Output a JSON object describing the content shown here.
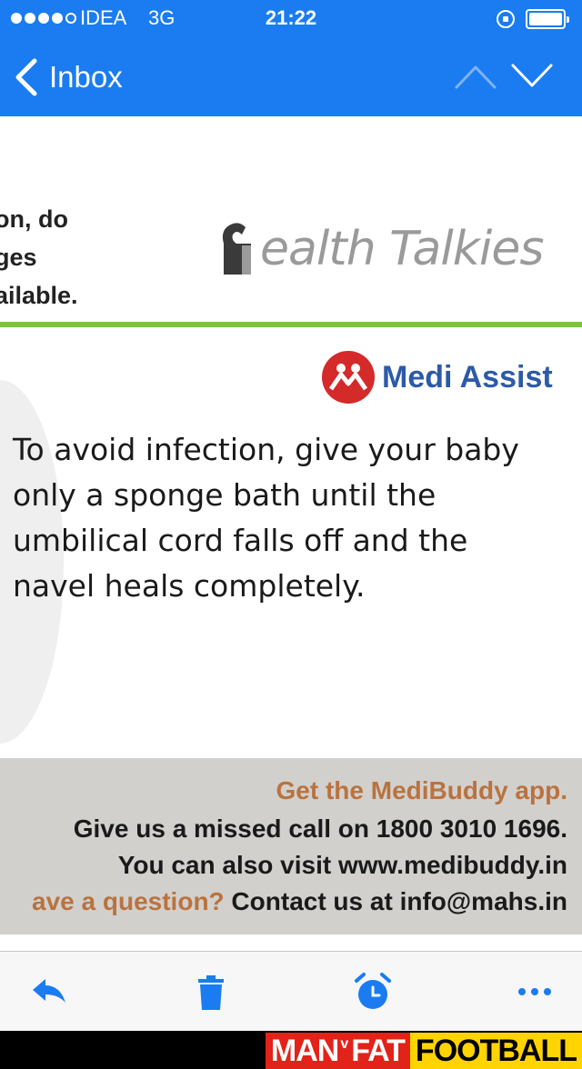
{
  "status_bar": {
    "carrier": "IDEA",
    "network": "3G",
    "time": "21:22"
  },
  "nav": {
    "back_label": "Inbox"
  },
  "email": {
    "left_cut_lines": [
      "on, do",
      "ges",
      "ailable."
    ],
    "brand_logo_text": "ealth Talkies",
    "partner_logo_text": "Medi Assist",
    "message": "To avoid infection, give your baby only a sponge bath until the umbilical cord falls off and the navel heals completely.",
    "footer": {
      "line1": "Get the MediBuddy app.",
      "line2": "Give us a missed call on 1800 3010 1696.",
      "line3": "You can also visit www.medibuddy.in",
      "line4_question": "ave a question?",
      "line4_contact": " Contact us at info@mahs.in"
    }
  },
  "banner": {
    "man": "MAN",
    "v": "v",
    "fat": "FAT",
    "football": "FOOTBALL"
  },
  "colors": {
    "header_blue": "#1a7cf0",
    "accent_green": "#7cc143",
    "medi_red": "#d42a2a",
    "medi_blue": "#2d5aa8",
    "footer_orange": "#b9733f"
  }
}
